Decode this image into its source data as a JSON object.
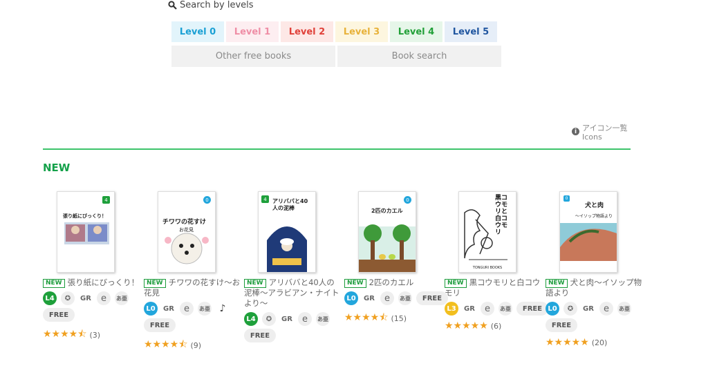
{
  "search": {
    "icon": "search-icon",
    "label": "Search by levels"
  },
  "levels": [
    "Level 0",
    "Level 1",
    "Level 2",
    "Level 3",
    "Level 4",
    "Level 5"
  ],
  "links": {
    "other": "Other free books",
    "search": "Book search"
  },
  "icons_link": {
    "line1": "アイコン一覧",
    "line2": "Icons"
  },
  "section": {
    "heading": "NEW"
  },
  "colors": {
    "green_accent": "#3cc36a",
    "level0": "#1aa0d4",
    "level1": "#ef8ea6",
    "level2": "#e0413a",
    "level3": "#e8b23a",
    "level4": "#21a038",
    "level5": "#2056a0",
    "star": "#f0a020"
  },
  "books": [
    {
      "badge": "NEW",
      "title": "張り紙にびっくり！",
      "level": "L4",
      "tags": [
        "GR",
        "e"
      ],
      "kanji": "あ亜",
      "free": "FREE",
      "stars": "★★★★⯪",
      "count": "(3)",
      "cover_title": "張り紙にびっくり！",
      "cover_level": "4"
    },
    {
      "badge": "NEW",
      "title": "チワワの花すけ〜お花見",
      "level": "L0",
      "tags": [
        "GR",
        "e"
      ],
      "kanji": "あ亜",
      "music": "♪",
      "free": "FREE",
      "stars": "★★★★⯪",
      "count": "(9)",
      "cover_title": "チワワの花すけ",
      "cover_sub": "お花見",
      "cover_level": "0"
    },
    {
      "badge": "NEW",
      "title": "アリババと40人の泥棒〜アラビアン・ナイトより〜",
      "level": "L4",
      "tags": [
        "GR",
        "e"
      ],
      "kanji": "あ亜",
      "free": "FREE",
      "stars": "",
      "count": "",
      "cover_title": "アリババと40人の泥棒",
      "cover_level": "4"
    },
    {
      "badge": "NEW",
      "title": "2匹のカエル",
      "level": "L0",
      "tags": [
        "GR",
        "e"
      ],
      "kanji": "あ亜",
      "free": "FREE",
      "stars": "★★★★⯪",
      "count": "(15)",
      "cover_title": "2匹のカエル",
      "cover_level": "0"
    },
    {
      "badge": "NEW",
      "title": "黒コウモリと白コウモリ",
      "level": "L3",
      "tags": [
        "GR",
        "e"
      ],
      "kanji": "あ亜",
      "free": "FREE",
      "stars": "★★★★★",
      "count": "(6)",
      "cover_title": "黒コウモリと白コウモリ",
      "cover_pub": "TONGURI BOOKS"
    },
    {
      "badge": "NEW",
      "title": "犬と肉〜イソップ物語より",
      "level": "L0",
      "tags": [
        "GR",
        "e"
      ],
      "kanji": "あ亜",
      "free": "FREE",
      "stars": "★★★★★",
      "count": "(20)",
      "cover_title": "犬と肉",
      "cover_sub": "〜イソップ物語より",
      "cover_level": "0"
    }
  ]
}
